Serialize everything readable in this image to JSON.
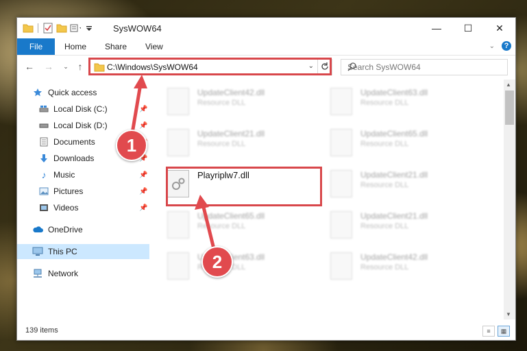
{
  "window": {
    "title": "SysWOW64",
    "controls": {
      "minimize": "—",
      "maximize": "☐",
      "close": "✕"
    }
  },
  "ribbon": {
    "tabs": [
      "File",
      "Home",
      "Share",
      "View"
    ],
    "help": "?"
  },
  "navigation": {
    "address": "C:\\Windows\\SysWOW64",
    "search_placeholder": "Search SysWOW64"
  },
  "sidebar": {
    "items": [
      {
        "label": "Quick access",
        "icon": "star-icon",
        "pinned": false
      },
      {
        "label": "Local Disk (C:)",
        "icon": "drive-icon",
        "pinned": true
      },
      {
        "label": "Local Disk (D:)",
        "icon": "drive-icon",
        "pinned": true
      },
      {
        "label": "Documents",
        "icon": "documents-icon",
        "pinned": true
      },
      {
        "label": "Downloads",
        "icon": "downloads-icon",
        "pinned": true
      },
      {
        "label": "Music",
        "icon": "music-icon",
        "pinned": true
      },
      {
        "label": "Pictures",
        "icon": "pictures-icon",
        "pinned": true
      },
      {
        "label": "Videos",
        "icon": "videos-icon",
        "pinned": true
      },
      {
        "label": "OneDrive",
        "icon": "cloud-icon",
        "pinned": false
      },
      {
        "label": "This PC",
        "icon": "computer-icon",
        "pinned": false,
        "selected": true
      },
      {
        "label": "Network",
        "icon": "network-icon",
        "pinned": false
      }
    ]
  },
  "files": [
    {
      "name": "UpdateClient42.dll",
      "type": "Resource DLL"
    },
    {
      "name": "UpdateClient63.dll",
      "type": "Resource DLL"
    },
    {
      "name": "UpdateClient21.dll",
      "type": "Resource DLL"
    },
    {
      "name": "UpdateClient65.dll",
      "type": "Resource DLL"
    },
    {
      "name": "Playriplw7.dll",
      "type": ""
    },
    {
      "name": "UpdateClient21.dll",
      "type": "Resource DLL"
    },
    {
      "name": "UpdateClient65.dll",
      "type": "Resource DLL"
    },
    {
      "name": "UpdateClient21.dll",
      "type": "Resource DLL"
    },
    {
      "name": "UpdateClient63.dll",
      "type": "Resource DLL"
    },
    {
      "name": "UpdateClient42.dll",
      "type": "Resource DLL"
    }
  ],
  "status": {
    "item_count": "139 items"
  },
  "callouts": [
    "1",
    "2"
  ],
  "colors": {
    "accent": "#1979ca",
    "highlight": "#d8474b",
    "selected": "#cce8ff"
  }
}
